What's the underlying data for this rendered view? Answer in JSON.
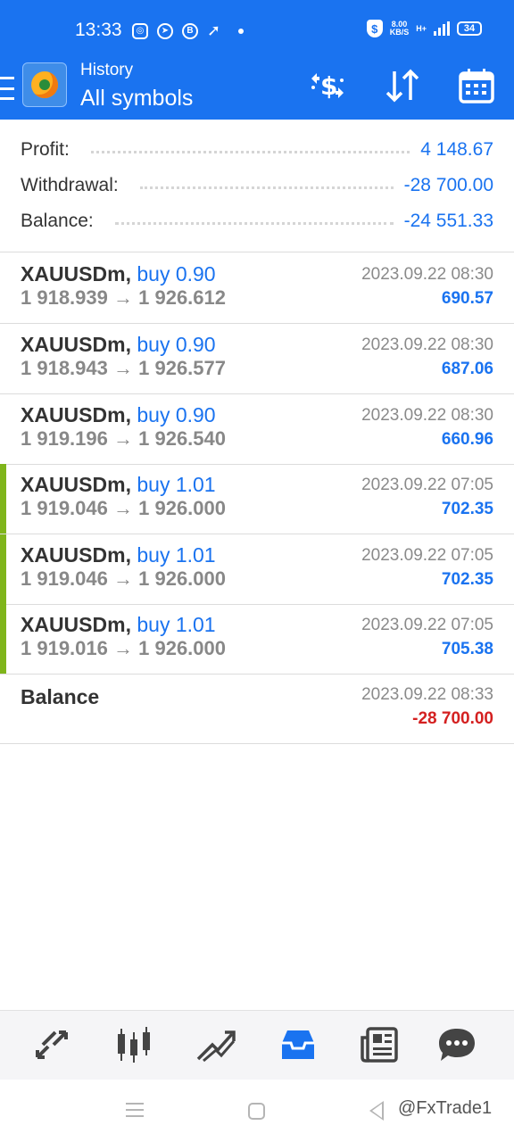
{
  "status_bar": {
    "time": "13:33",
    "speed_value": "8.00",
    "speed_unit": "KB/S",
    "network": "H+",
    "battery": "34",
    "icons": [
      "instagram-icon",
      "telegram-icon",
      "b-app-icon",
      "navigation-icon",
      "shield-icon",
      "signal-icon",
      "battery-icon"
    ]
  },
  "header": {
    "subtitle": "History",
    "title": "All symbols",
    "actions": [
      "currency-exchange-icon",
      "sort-icon",
      "calendar-icon"
    ],
    "accent_color": "#1a73f0"
  },
  "summary": {
    "profit_label": "Profit:",
    "profit_value": "4 148.67",
    "withdrawal_label": "Withdrawal:",
    "withdrawal_value": "-28 700.00",
    "balance_label": "Balance:",
    "balance_value": "-24 551.33"
  },
  "deals": [
    {
      "symbol": "XAUUSDm,",
      "side": "buy 0.90",
      "open_price": "1 918.939",
      "close_price": "1 926.612",
      "time": "2023.09.22 08:30",
      "profit": "690.57"
    },
    {
      "symbol": "XAUUSDm,",
      "side": "buy 0.90",
      "open_price": "1 918.943",
      "close_price": "1 926.577",
      "time": "2023.09.22 08:30",
      "profit": "687.06"
    },
    {
      "symbol": "XAUUSDm,",
      "side": "buy 0.90",
      "open_price": "1 919.196",
      "close_price": "1 926.540",
      "time": "2023.09.22 08:30",
      "profit": "660.96"
    },
    {
      "symbol": "XAUUSDm,",
      "side": "buy 1.01",
      "open_price": "1 919.046",
      "close_price": "1 926.000",
      "time": "2023.09.22 07:05",
      "profit": "702.35"
    },
    {
      "symbol": "XAUUSDm,",
      "side": "buy 1.01",
      "open_price": "1 919.046",
      "close_price": "1 926.000",
      "time": "2023.09.22 07:05",
      "profit": "702.35"
    },
    {
      "symbol": "XAUUSDm,",
      "side": "buy 1.01",
      "open_price": "1 919.016",
      "close_price": "1 926.000",
      "time": "2023.09.22 07:05",
      "profit": "705.38"
    }
  ],
  "arrow": "→",
  "balance_entry": {
    "label": "Balance",
    "time": "2023.09.22 08:33",
    "amount": "-28 700.00"
  },
  "bottom_nav": [
    "quotes-icon",
    "chart-icon",
    "trade-icon",
    "history-icon",
    "news-icon",
    "chat-icon"
  ],
  "active_tab": "history-icon",
  "watermark": "@FxTrade1",
  "colors": {
    "positive": "#1a73f0",
    "negative": "#d42020",
    "marker": "#7fb51b"
  }
}
